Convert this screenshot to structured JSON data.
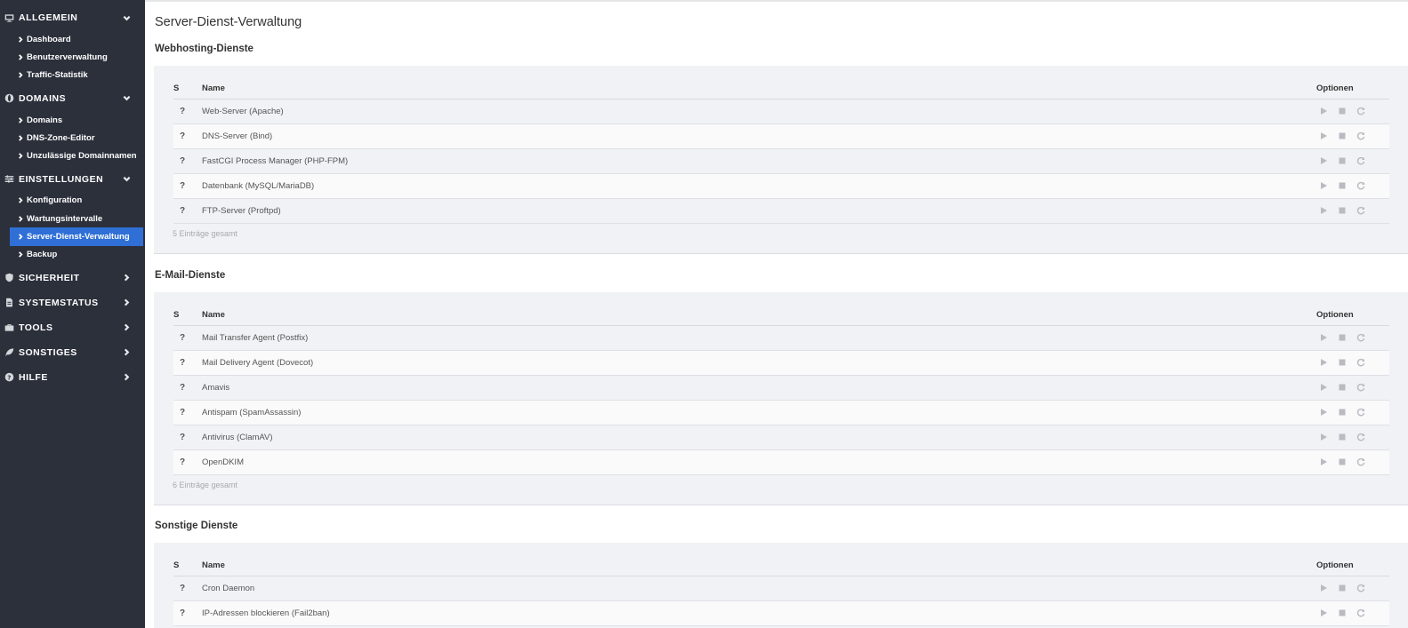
{
  "sidebar": {
    "groups": [
      {
        "label": "ALLGEMEIN",
        "icon": "monitor-icon",
        "expanded": true,
        "items": [
          {
            "label": "Dashboard"
          },
          {
            "label": "Benutzerverwaltung"
          },
          {
            "label": "Traffic-Statistik"
          }
        ]
      },
      {
        "label": "DOMAINS",
        "icon": "globe-icon",
        "expanded": true,
        "items": [
          {
            "label": "Domains"
          },
          {
            "label": "DNS-Zone-Editor"
          },
          {
            "label": "Unzulässige Domainnamen"
          }
        ]
      },
      {
        "label": "EINSTELLUNGEN",
        "icon": "sliders-icon",
        "expanded": true,
        "items": [
          {
            "label": "Konfiguration"
          },
          {
            "label": "Wartungsintervalle"
          },
          {
            "label": "Server-Dienst-Verwaltung",
            "active": true
          },
          {
            "label": "Backup"
          }
        ]
      },
      {
        "label": "SICHERHEIT",
        "icon": "shield-icon",
        "expanded": false,
        "items": []
      },
      {
        "label": "SYSTEMSTATUS",
        "icon": "document-icon",
        "expanded": false,
        "items": []
      },
      {
        "label": "TOOLS",
        "icon": "toolbox-icon",
        "expanded": false,
        "items": []
      },
      {
        "label": "SONSTIGES",
        "icon": "leaf-icon",
        "expanded": false,
        "items": []
      },
      {
        "label": "HILFE",
        "icon": "question-circle-icon",
        "expanded": false,
        "items": []
      }
    ]
  },
  "main": {
    "title": "Server-Dienst-Verwaltung",
    "columns": {
      "status": "S",
      "name": "Name",
      "options": "Optionen"
    },
    "sections": [
      {
        "title": "Webhosting-Dienste",
        "rows": [
          {
            "status": "?",
            "name": "Web-Server (Apache)"
          },
          {
            "status": "?",
            "name": "DNS-Server (Bind)"
          },
          {
            "status": "?",
            "name": "FastCGI Process Manager (PHP-FPM)"
          },
          {
            "status": "?",
            "name": "Datenbank (MySQL/MariaDB)"
          },
          {
            "status": "?",
            "name": "FTP-Server (Proftpd)"
          }
        ],
        "total": "5 Einträge gesamt"
      },
      {
        "title": "E-Mail-Dienste",
        "rows": [
          {
            "status": "?",
            "name": "Mail Transfer Agent (Postfix)"
          },
          {
            "status": "?",
            "name": "Mail Delivery Agent (Dovecot)"
          },
          {
            "status": "?",
            "name": "Amavis"
          },
          {
            "status": "?",
            "name": "Antispam (SpamAssassin)"
          },
          {
            "status": "?",
            "name": "Antivirus (ClamAV)"
          },
          {
            "status": "?",
            "name": "OpenDKIM"
          }
        ],
        "total": "6 Einträge gesamt"
      },
      {
        "title": "Sonstige Dienste",
        "rows": [
          {
            "status": "?",
            "name": "Cron Daemon"
          },
          {
            "status": "?",
            "name": "IP-Adressen blockieren (Fail2ban)"
          }
        ],
        "total": ""
      }
    ],
    "option_icons": [
      "play-icon",
      "stop-icon",
      "restart-icon"
    ]
  },
  "colors": {
    "sidebar_bg": "#2b303b",
    "active_item": "#2f6fd6",
    "panel_bg": "#f1f2f6",
    "icon_disabled": "#b9bbc1"
  }
}
